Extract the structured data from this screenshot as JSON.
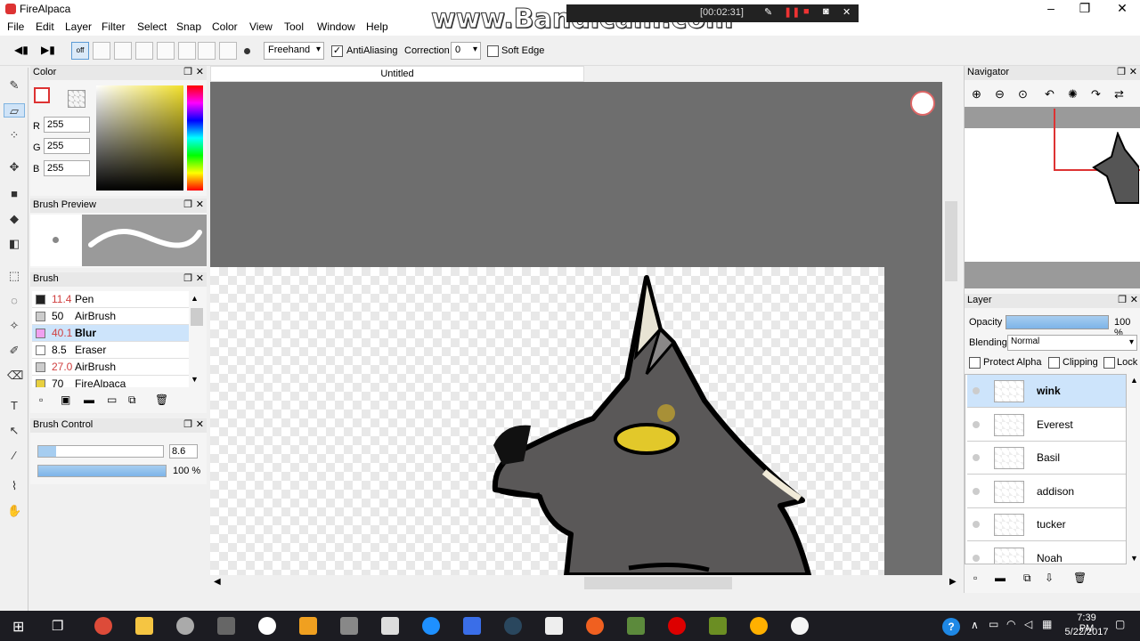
{
  "window": {
    "title": "FireAlpaca"
  },
  "menu": [
    "File",
    "Edit",
    "Layer",
    "Filter",
    "Select",
    "Snap",
    "Color",
    "View",
    "Tool",
    "Window",
    "Help"
  ],
  "toolbar": {
    "mode": "Freehand",
    "antialiasing_label": "AntiAliasing",
    "antialiasing_checked": true,
    "correction_label": "Correction",
    "correction_value": "0",
    "soft_edge_label": "Soft Edge",
    "soft_edge_checked": false
  },
  "overlay": {
    "watermark": "www.Bandicam.com",
    "timer": "[00:02:31]"
  },
  "color_panel": {
    "title": "Color",
    "r_label": "R",
    "g_label": "G",
    "b_label": "B",
    "r": "255",
    "g": "255",
    "b": "255"
  },
  "brush_preview": {
    "title": "Brush Preview"
  },
  "brush_panel": {
    "title": "Brush",
    "items": [
      {
        "size": "11.4",
        "name": "Pen",
        "swatch": "#222222",
        "size_color": "#d04040"
      },
      {
        "size": "50",
        "name": "AirBrush",
        "swatch": "#cccccc",
        "size_color": "#000000"
      },
      {
        "size": "40.1",
        "name": "Blur",
        "swatch": "#f0a0f0",
        "size_color": "#d04040"
      },
      {
        "size": "8.5",
        "name": "Eraser",
        "swatch": "#ffffff",
        "size_color": "#000000"
      },
      {
        "size": "27.0",
        "name": "AirBrush",
        "swatch": "#cccccc",
        "size_color": "#d04040"
      },
      {
        "size": "70",
        "name": "FireAlpaca",
        "swatch": "#e8d040",
        "size_color": "#000000"
      }
    ],
    "selected_index": 2
  },
  "brush_control": {
    "title": "Brush Control",
    "size": "8.6",
    "opacity": "100 %",
    "size_fraction": 0.14,
    "opacity_fraction": 1.0
  },
  "document": {
    "tab_title": "Untitled"
  },
  "navigator": {
    "title": "Navigator"
  },
  "layer_panel": {
    "title": "Layer",
    "opacity_label": "Opacity",
    "opacity_value": "100 %",
    "opacity_fraction": 1.0,
    "blending_label": "Blending",
    "blending_value": "Normal",
    "protect_alpha": "Protect Alpha",
    "clipping": "Clipping",
    "lock": "Lock",
    "layers": [
      "wink",
      "Everest",
      "Basil",
      "addison",
      "tucker",
      "Noah"
    ],
    "selected_index": 0
  },
  "taskbar": {
    "time": "7:39 PM",
    "date": "5/22/2017"
  },
  "colors": {
    "accent": "#cde4fb",
    "canvas_bg": "#6e6e6e",
    "taskbar": "#1c1c22"
  }
}
